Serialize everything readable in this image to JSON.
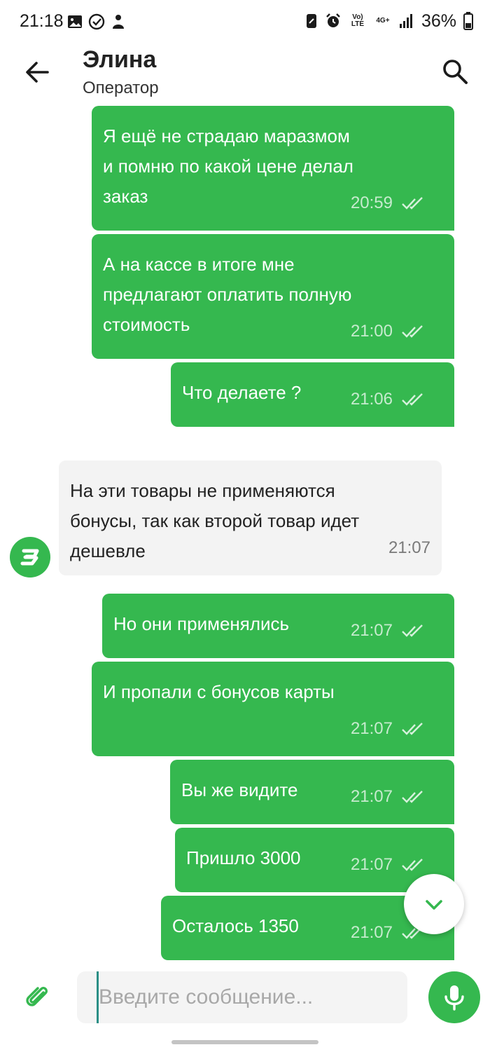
{
  "status_bar": {
    "time": "21:18",
    "battery_percent": "36%",
    "lte_tag": "Vo) LTE",
    "net_tag": "4G+",
    "icons": [
      "image-icon",
      "check-circle-icon",
      "person-icon",
      "nfc-icon",
      "alarm-icon",
      "volte-icon",
      "4g-icon",
      "signal-icon",
      "battery-icon"
    ]
  },
  "header": {
    "name": "Элина",
    "status": "Оператор"
  },
  "messages": [
    {
      "dir": "out",
      "text": "Я ещё не страдаю маразмом\nи помню по какой цене делал\nзаказ",
      "time": "20:59"
    },
    {
      "dir": "out",
      "text": "А на кассе в итоге мне\nпредлагают оплатить полную\nстоимость",
      "time": "21:00"
    },
    {
      "dir": "out",
      "text": "Что делаете ?",
      "time": "21:06"
    },
    {
      "dir": "in",
      "text": "На эти товары не применяются\nбонусы, так как второй товар идет\nдешевле",
      "time": "21:07"
    },
    {
      "dir": "out",
      "text": "Но они применялись",
      "time": "21:07"
    },
    {
      "dir": "out",
      "text": "И пропали с бонусов карты",
      "time": "21:07"
    },
    {
      "dir": "out",
      "text": "Вы же видите",
      "time": "21:07"
    },
    {
      "dir": "out",
      "text": "Пришло 3000",
      "time": "21:07"
    },
    {
      "dir": "out",
      "text": "Осталось 1350",
      "time": "21:07"
    }
  ],
  "input": {
    "placeholder": "Введите сообщение...",
    "value": ""
  },
  "colors": {
    "accent": "#35b84f",
    "incoming_bg": "#f3f3f3",
    "input_bg": "#f4f4f4"
  }
}
